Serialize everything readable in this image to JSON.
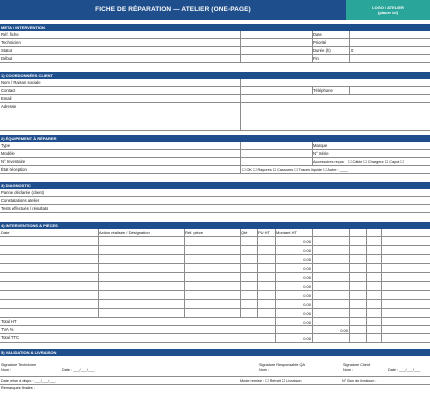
{
  "header": {
    "title": "FICHE DE RÉPARATION — ATELIER (ONE-PAGE)",
    "logo_line1": "LOGO / ATELIER",
    "logo_line2": "(placer ici)"
  },
  "meta": {
    "section_title": "META / INTERVENTION",
    "left_labels": [
      "Réf. fiche",
      "Technicien",
      "Statut",
      "Début"
    ],
    "right_labels": [
      "Date",
      "Priorité",
      "Durée (h)",
      "Fin"
    ],
    "right_values": [
      "",
      "",
      "0",
      ""
    ]
  },
  "client": {
    "section_title": "1) COORDONNÉES CLIENT",
    "labels": [
      "Nom / Raison sociale",
      "Contact",
      "Email",
      "Adresse"
    ],
    "phone_label": "Téléphone"
  },
  "equipment": {
    "section_title": "2) ÉQUIPEMENT À RÉPARER",
    "left_labels": [
      "Type",
      "Modèle",
      "N° Inventaire",
      "État réception"
    ],
    "right_labels": [
      "Marque",
      "N° Série",
      "Accessoires reçus"
    ],
    "accessories_options": "☐ Câble  ☐ Chargeur  ☐ Capot  ☐",
    "state_options": "☐ OK  ☐ Rayures  ☐ Cassures  ☐ Traces liquide  ☐ Autre : ____"
  },
  "diagnostic": {
    "section_title": "3) DIAGNOSTIC",
    "labels": [
      "Panne déclarée (client)",
      "Constatations atelier",
      "Tests effectués / résultats"
    ]
  },
  "interventions": {
    "section_title": "4) INTERVENTIONS & PIÈCES",
    "columns": [
      "Date",
      "Action réalisée / Désignation",
      "Réf. pièce",
      "Qté",
      "PU HT",
      "Montant HT"
    ],
    "amounts": [
      "0.00",
      "0.00",
      "0.00",
      "0.00",
      "0.00",
      "0.00",
      "0.00",
      "0.00",
      "0.00"
    ],
    "totals_labels": [
      "Total HT",
      "TVA %",
      "Total TTC"
    ],
    "totals_values": [
      "0.00",
      "0.00",
      "0.00"
    ]
  },
  "validation": {
    "section_title": "5) VALIDATION & LIVRAISON",
    "sig_tech": "Signature Technicien",
    "sig_qa": "Signature Responsable QA",
    "sig_client": "Signature Client",
    "nom_label": "Nom :",
    "date_label": "Date : ___/___/___",
    "date_dispo": "Date mise à dispo :  ___/___/___",
    "mode_remise": "Mode remise : ☐ Retrait  ☐ Livraison",
    "bon_livraison": "N° Bon de livraison :",
    "remarks": "Remarques finales :"
  }
}
